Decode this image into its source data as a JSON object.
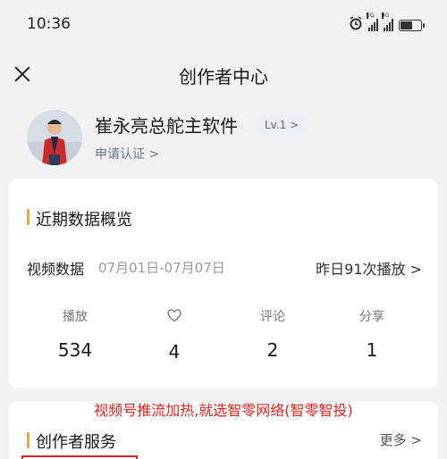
{
  "status_bar": {
    "time": "10:36",
    "sig1_tag": "5G",
    "sig2_tag": "4G"
  },
  "header": {
    "title": "创作者中心"
  },
  "profile": {
    "name": "崔永亮总舵主软件",
    "level": "Lv.1 >",
    "apply": "申请认证 >"
  },
  "data_overview": {
    "title": "近期数据概览",
    "video_label": "视频数据",
    "date_range": "07月01日-07月07日",
    "yesterday": "昨日91次播放 >",
    "stats": [
      {
        "label": "播放",
        "value": "534"
      },
      {
        "label": "",
        "icon": "heart-icon",
        "value": "4"
      },
      {
        "label": "评论",
        "value": "2"
      },
      {
        "label": "分享",
        "value": "1"
      }
    ]
  },
  "watermark": "视频号推流加热,就选智零网络(智零智投)",
  "service": {
    "title": "创作者服务",
    "more": "更多 >"
  },
  "colors": {
    "accent": "#e8a64a",
    "watermark": "#e0231d",
    "link": "#6b7a94"
  }
}
